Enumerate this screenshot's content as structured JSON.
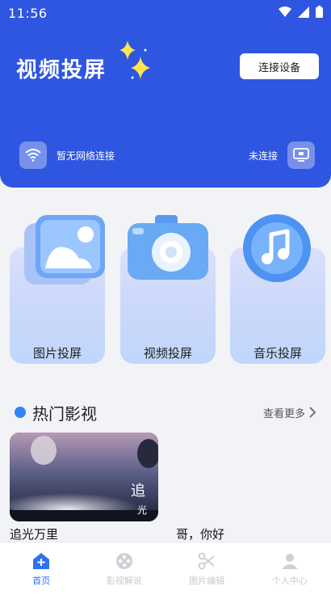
{
  "status_bar": {
    "time": "11:56"
  },
  "header": {
    "title": "视频投屏",
    "connect_button": "连接设备",
    "network_status": "暂无网络连接",
    "connection_status": "未连接"
  },
  "features": [
    {
      "label": "图片投屏",
      "icon": "image-icon"
    },
    {
      "label": "视频投屏",
      "icon": "camera-icon"
    },
    {
      "label": "音乐投屏",
      "icon": "music-icon"
    }
  ],
  "hot_section": {
    "title": "热门影视",
    "more_label": "查看更多",
    "movies": [
      {
        "title": "追光万里"
      },
      {
        "title": "哥，你好"
      }
    ]
  },
  "bottom_nav": [
    {
      "label": "首页",
      "icon": "home-icon",
      "active": true
    },
    {
      "label": "影视解说",
      "icon": "film-reel-icon",
      "active": false
    },
    {
      "label": "图片编辑",
      "icon": "scissors-icon",
      "active": false
    },
    {
      "label": "个人中心",
      "icon": "user-icon",
      "active": false
    }
  ],
  "colors": {
    "primary": "#2f56e0",
    "accent": "#2f86f6",
    "nav_active": "#2f6ff0"
  }
}
